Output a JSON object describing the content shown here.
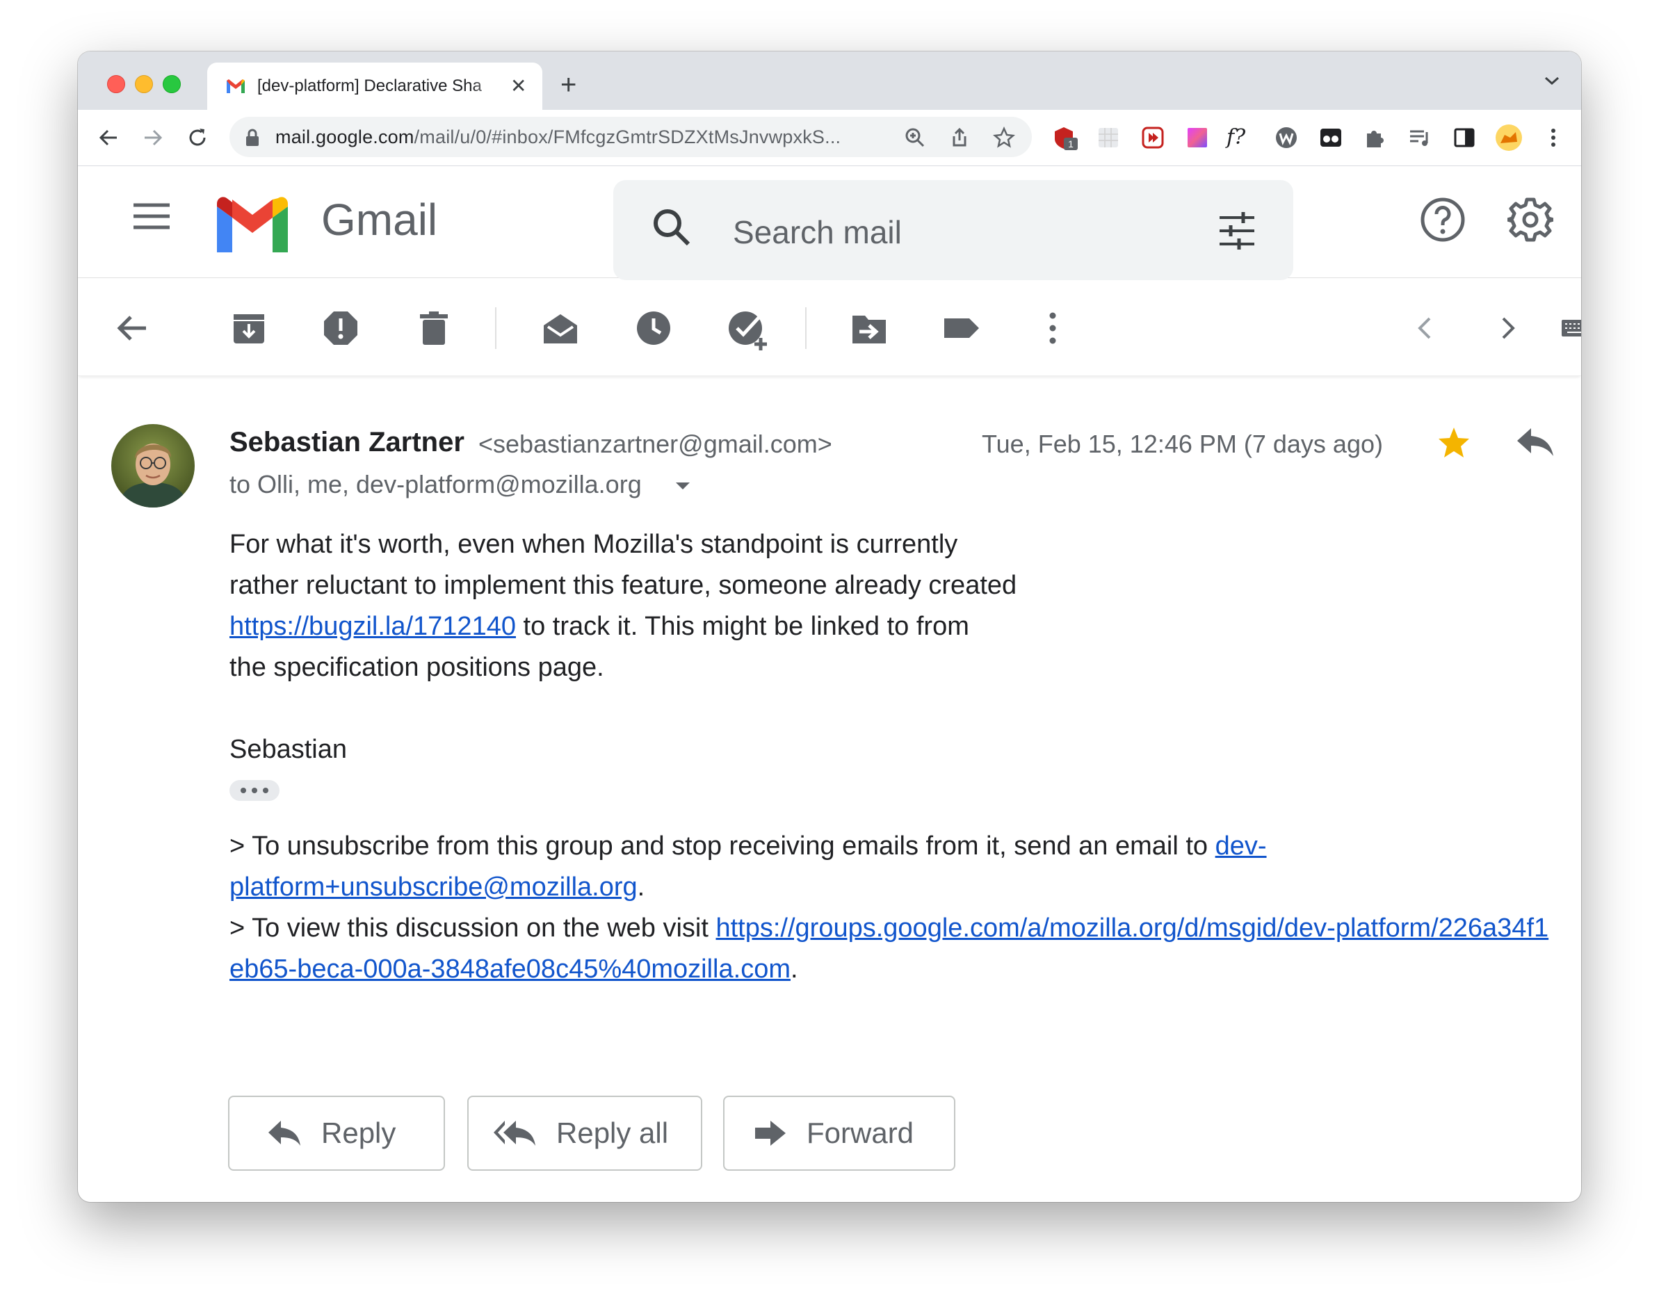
{
  "browser": {
    "tab_title": "[dev-platform] Declarative Sha",
    "url_host": "mail.google.com",
    "url_path": "/mail/u/0/#inbox/FMfcgzGmtrSDZXtMsJnvwpxkS...",
    "extension_badge": "1",
    "extension_fx_label": "f?"
  },
  "gmail": {
    "wordmark": "Gmail",
    "search_placeholder": "Search mail"
  },
  "message": {
    "sender_name": "Sebastian Zartner",
    "sender_email": "<sebastianzartner@gmail.com>",
    "recipients": "to Olli, me, dev-platform@mozilla.org",
    "date": "Tue, Feb 15, 12:46 PM (7 days ago)",
    "starred": true,
    "para1_line1": "For what it's worth, even when Mozilla's standpoint is currently",
    "para1_line2": "rather reluctant to implement this feature, someone already created",
    "para1_link": "https://bugzil.la/1712140",
    "para1_line3_rest": " to track it. This might be linked to from",
    "para1_line4": "the specification positions page.",
    "signature": "Sebastian",
    "footer1_prefix": "> To unsubscribe from this group and stop receiving emails from it, send an email to ",
    "footer1_link_a": "dev-",
    "footer1_link_b": "platform+unsubscribe@mozilla.org",
    "footer1_suffix": ".",
    "footer2_prefix": "> To view this discussion on the web visit ",
    "footer2_link_a": "https://groups.google.com/a/mozilla.org/d/msgid/dev-platform/226a34f1",
    "footer2_link_b": "eb65-beca-000a-3848afe08c45%40mozilla.com",
    "footer2_suffix": "."
  },
  "buttons": {
    "reply": "Reply",
    "reply_all": "Reply all",
    "forward": "Forward"
  },
  "colors": {
    "link": "#1155cc",
    "star": "#f4b400",
    "icon": "#5f6368"
  }
}
